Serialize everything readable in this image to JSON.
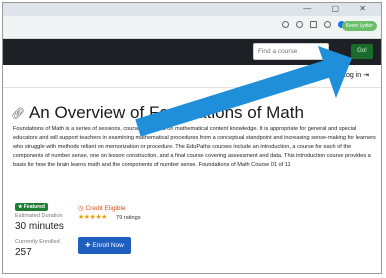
{
  "browser": {
    "window_controls": "— ▢ ✕",
    "profile_label": "Kevin Lyster"
  },
  "header": {
    "search_placeholder": "Find a course",
    "go_label": "Go!",
    "login_label": "Log in ⇥"
  },
  "course": {
    "title": "An Overview of Foundations of Math",
    "description": "Foundations of Math is a series of sessions, courses, focused on mathematical content knowledge. It is appropriate for general and special educators and will support teachers in examining mathematical procedures from a conceptual standpoint and increasing sense-making for learners who struggle with methods reliant on memorization or procedure. The EduPaths courses include an introduction, a course for each of the components of number sense, one on lesson construction, and a final course covering assessment and data. This introduction course provides a basis for how the brain learns math and the components of number sense. Foundations of Math Course 01 of 11",
    "featured_label": "★ Featured",
    "duration_label": "Estimated Duration",
    "duration_value": "30 minutes",
    "enrolled_label": "Currently Enrolled",
    "enrolled_value": "257",
    "credit_label": "Credit Eligible",
    "stars": "★★★★★",
    "ratings_text": "79 ratings",
    "enroll_label": "Enroll Now"
  },
  "colors": {
    "header_bg": "#1d2125",
    "accent_blue": "#1f5fbf",
    "featured_green": "#1e7c35",
    "credit_orange": "#d0521c",
    "arrow_blue": "#1e8fd8"
  }
}
